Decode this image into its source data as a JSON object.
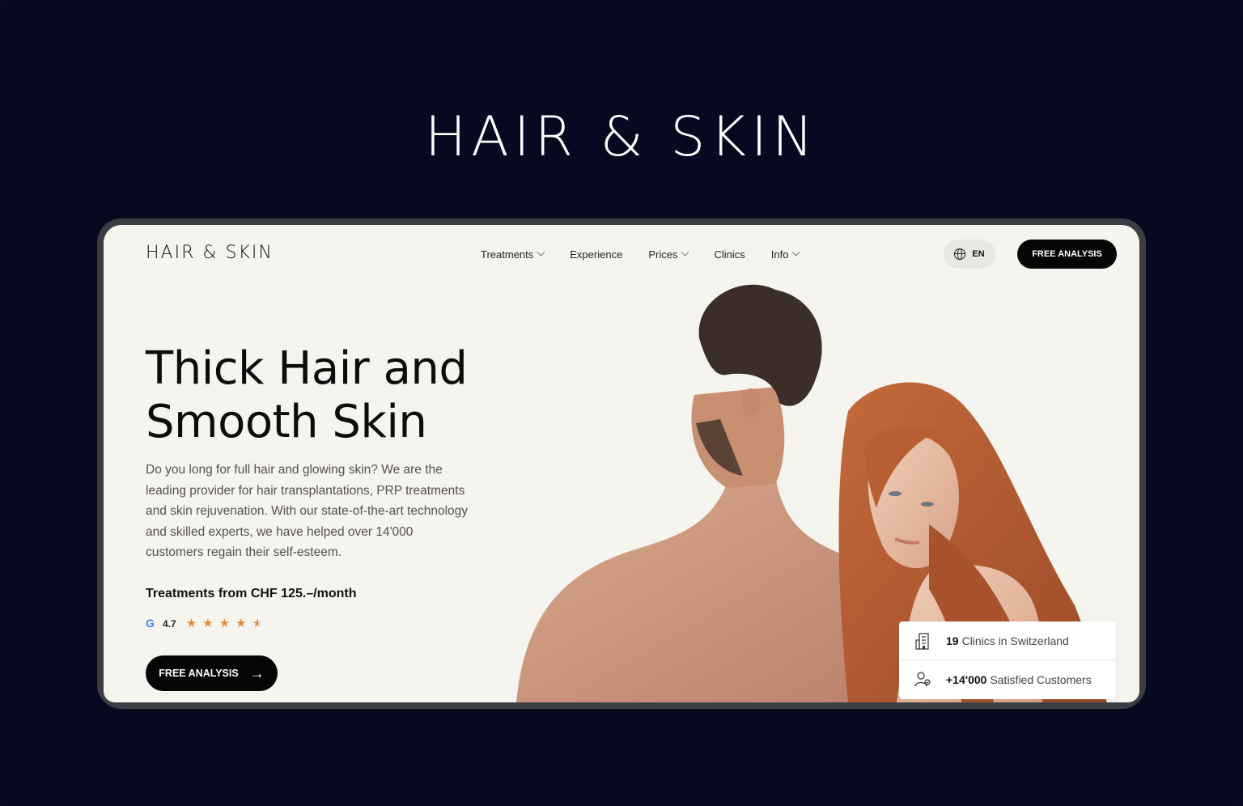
{
  "hero_brand": "HAIR & SKIN",
  "header": {
    "logo": "HAIR & SKIN",
    "nav": [
      {
        "label": "Treatments",
        "has_dropdown": true
      },
      {
        "label": "Experience",
        "has_dropdown": false
      },
      {
        "label": "Prices",
        "has_dropdown": true
      },
      {
        "label": "Clinics",
        "has_dropdown": false
      },
      {
        "label": "Info",
        "has_dropdown": true
      }
    ],
    "language": "EN",
    "cta_label": "FREE ANALYSIS"
  },
  "hero": {
    "title_line1": "Thick Hair and",
    "title_line2": "Smooth Skin",
    "description": "Do you long for full hair and glowing skin? We are the leading provider for hair transplantations, PRP treatments and skin rejuvenation. With our state-of-the-art technology and skilled experts, we have helped over 14'000 customers regain their self-esteem.",
    "price": "Treatments from CHF 125.–/month",
    "rating_value": "4.7",
    "rating_stars": 4.5,
    "cta_label": "FREE ANALYSIS"
  },
  "stats": {
    "clinics_number": "19",
    "clinics_label": "Clinics in Switzerland",
    "customers_number": "+14'000",
    "customers_label": "Satisfied Customers"
  },
  "colors": {
    "page_bg": "#070a22",
    "screen_bg": "#f6f4ef",
    "button_bg": "#050505",
    "star": "#e9892f"
  }
}
